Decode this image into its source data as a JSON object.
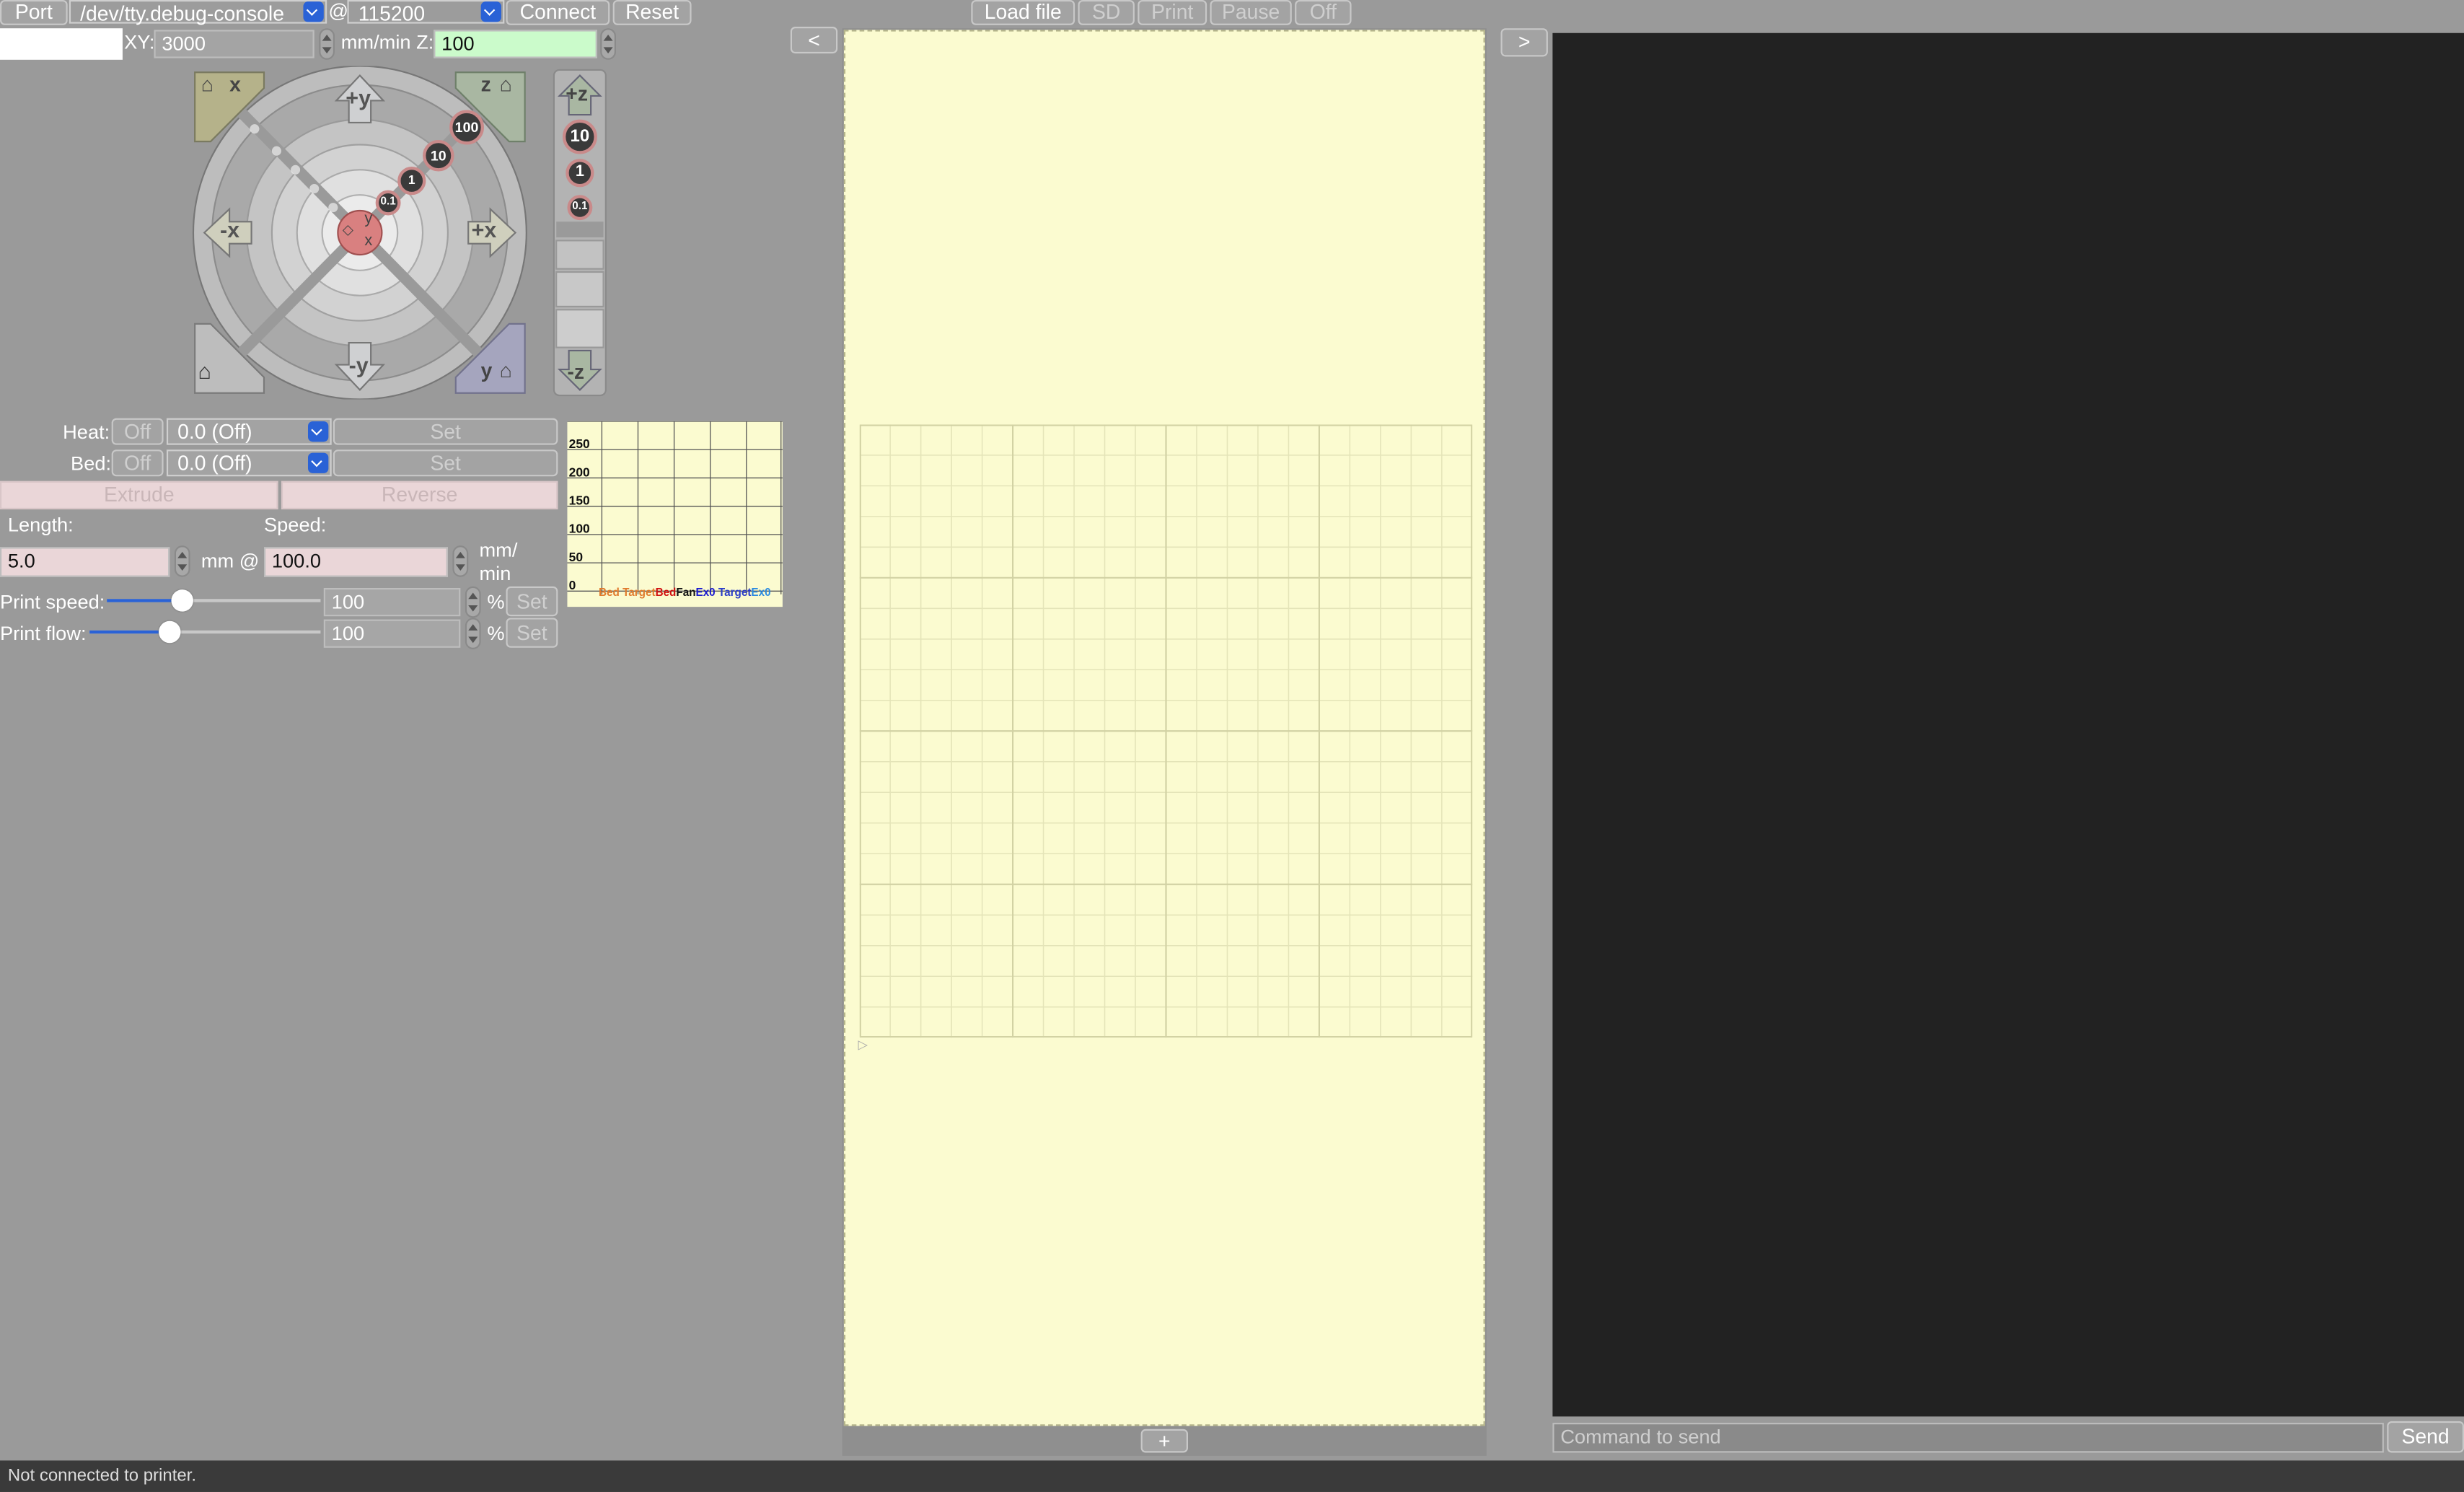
{
  "connection": {
    "port_button": "Port",
    "port_value": "/dev/tty.debug-console",
    "at": "@",
    "baud_value": "115200",
    "connect_button": "Connect",
    "reset_button": "Reset"
  },
  "toolbar": {
    "load_file": "Load file",
    "sd": "SD",
    "print": "Print",
    "pause": "Pause",
    "off": "Off"
  },
  "feed": {
    "xy_label": "XY:",
    "xy_value": "3000",
    "unit_label": "mm/min Z:",
    "z_value": "100"
  },
  "jog": {
    "plus_y": "+y",
    "minus_y": "-y",
    "plus_x": "+x",
    "minus_x": "-x",
    "home_x": "x",
    "home_z": "z",
    "home_y": "y",
    "steps_xy": [
      "100",
      "10",
      "1",
      "0.1"
    ],
    "center_y": "y",
    "center_x": "x",
    "plus_z": "+z",
    "minus_z": "-z",
    "steps_z": [
      "10",
      "1",
      "0.1"
    ]
  },
  "temps": {
    "heat_label": "Heat:",
    "bed_label": "Bed:",
    "off_button": "Off",
    "heat_value": "0.0 (Off)",
    "bed_value": "0.0 (Off)",
    "set_button": "Set"
  },
  "extrude": {
    "extrude_button": "Extrude",
    "reverse_button": "Reverse",
    "length_label": "Length:",
    "speed_label": "Speed:",
    "length_value": "5.0",
    "mm_at": "mm @",
    "speed_value": "100.0",
    "speed_unit": "mm/\nmin"
  },
  "print_speed": {
    "label": "Print speed:",
    "value": "100",
    "percent": "%",
    "set_button": "Set",
    "slider_fraction": 0.35
  },
  "print_flow": {
    "label": "Print flow:",
    "value": "100",
    "percent": "%",
    "set_button": "Set",
    "slider_fraction": 0.35
  },
  "temp_graph": {
    "y_ticks": [
      "250",
      "200",
      "150",
      "100",
      "50",
      "0"
    ],
    "legend": [
      {
        "text": "Bed Target",
        "color": "#e07a2c"
      },
      {
        "text": "Bed",
        "color": "#d01010"
      },
      {
        "text": "Fan",
        "color": "#111111"
      },
      {
        "text": "Ex0",
        "color": "#1a1ad0"
      },
      {
        "text": " Target",
        "color": "#2a3cc8"
      },
      {
        "text": "Ex0",
        "color": "#2a8ae0"
      }
    ]
  },
  "nav": {
    "collapse_left": "<",
    "collapse_right": ">",
    "add_button": "+"
  },
  "console": {
    "command_placeholder": "Command to send",
    "send_button": "Send"
  },
  "status": {
    "text": "Not connected to printer."
  },
  "colors": {
    "panel_bg": "#9a9a9a",
    "canvas_bg": "#fbfbd0",
    "console_bg": "#222222",
    "z_field_bg": "#cbfbcb",
    "extrude_field_bg": "#ead6d8",
    "accent": "#2a62d6"
  }
}
